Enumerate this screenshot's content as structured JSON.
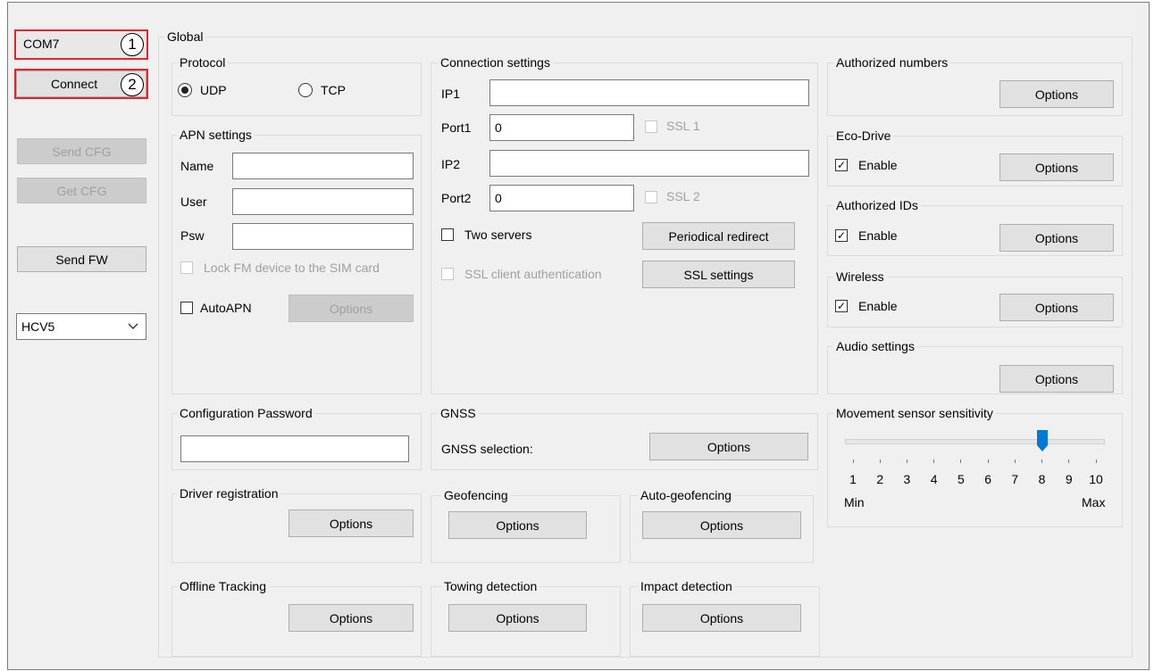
{
  "left_panel": {
    "com_port": "COM7",
    "connect_label": "Connect",
    "marker_1": "1",
    "marker_2": "2",
    "send_cfg_label": "Send CFG",
    "get_cfg_label": "Get CFG",
    "send_fw_label": "Send FW",
    "device_model": "HCV5"
  },
  "global": {
    "title": "Global",
    "protocol": {
      "title": "Protocol",
      "udp_label": "UDP",
      "tcp_label": "TCP",
      "selected": "UDP"
    },
    "apn": {
      "title": "APN settings",
      "name_label": "Name",
      "name_value": "",
      "user_label": "User",
      "user_value": "",
      "psw_label": "Psw",
      "psw_value": "",
      "lock_label": "Lock FM device to the SIM card",
      "autoapn_label": "AutoAPN",
      "options_label": "Options"
    },
    "connection": {
      "title": "Connection settings",
      "ip1_label": "IP1",
      "ip1_value": "",
      "port1_label": "Port1",
      "port1_value": "0",
      "ssl1_label": "SSL 1",
      "ip2_label": "IP2",
      "ip2_value": "",
      "port2_label": "Port2",
      "port2_value": "0",
      "ssl2_label": "SSL 2",
      "two_servers_label": "Two servers",
      "periodical_redirect_label": "Periodical redirect",
      "ssl_client_auth_label": "SSL client authentication",
      "ssl_settings_label": "SSL settings"
    },
    "authorized_numbers": {
      "title": "Authorized numbers",
      "options_label": "Options"
    },
    "eco_drive": {
      "title": "Eco-Drive",
      "enable_label": "Enable",
      "options_label": "Options"
    },
    "authorized_ids": {
      "title": "Authorized IDs",
      "enable_label": "Enable",
      "options_label": "Options"
    },
    "wireless": {
      "title": "Wireless",
      "enable_label": "Enable",
      "options_label": "Options"
    },
    "audio": {
      "title": "Audio settings",
      "options_label": "Options"
    },
    "config_password": {
      "title": "Configuration Password",
      "value": ""
    },
    "gnss": {
      "title": "GNSS",
      "selection_label": "GNSS selection:",
      "options_label": "Options"
    },
    "movement_sensor": {
      "title": "Movement sensor sensitivity",
      "value": 8,
      "ticks": [
        "1",
        "2",
        "3",
        "4",
        "5",
        "6",
        "7",
        "8",
        "9",
        "10"
      ],
      "min_label": "Min",
      "max_label": "Max"
    },
    "driver_registration": {
      "title": "Driver registration",
      "options_label": "Options"
    },
    "geofencing": {
      "title": "Geofencing",
      "options_label": "Options"
    },
    "auto_geofencing": {
      "title": "Auto-geofencing",
      "options_label": "Options"
    },
    "offline_tracking": {
      "title": "Offline Tracking",
      "options_label": "Options"
    },
    "towing_detection": {
      "title": "Towing detection",
      "options_label": "Options"
    },
    "impact_detection": {
      "title": "Impact detection",
      "options_label": "Options"
    }
  },
  "colors": {
    "window_bg": "#f0f0f0",
    "button_bg": "#e1e1e1",
    "highlight_red": "#e3242b",
    "slider_blue": "#0078d7",
    "disabled_text": "#a0a0a0"
  }
}
